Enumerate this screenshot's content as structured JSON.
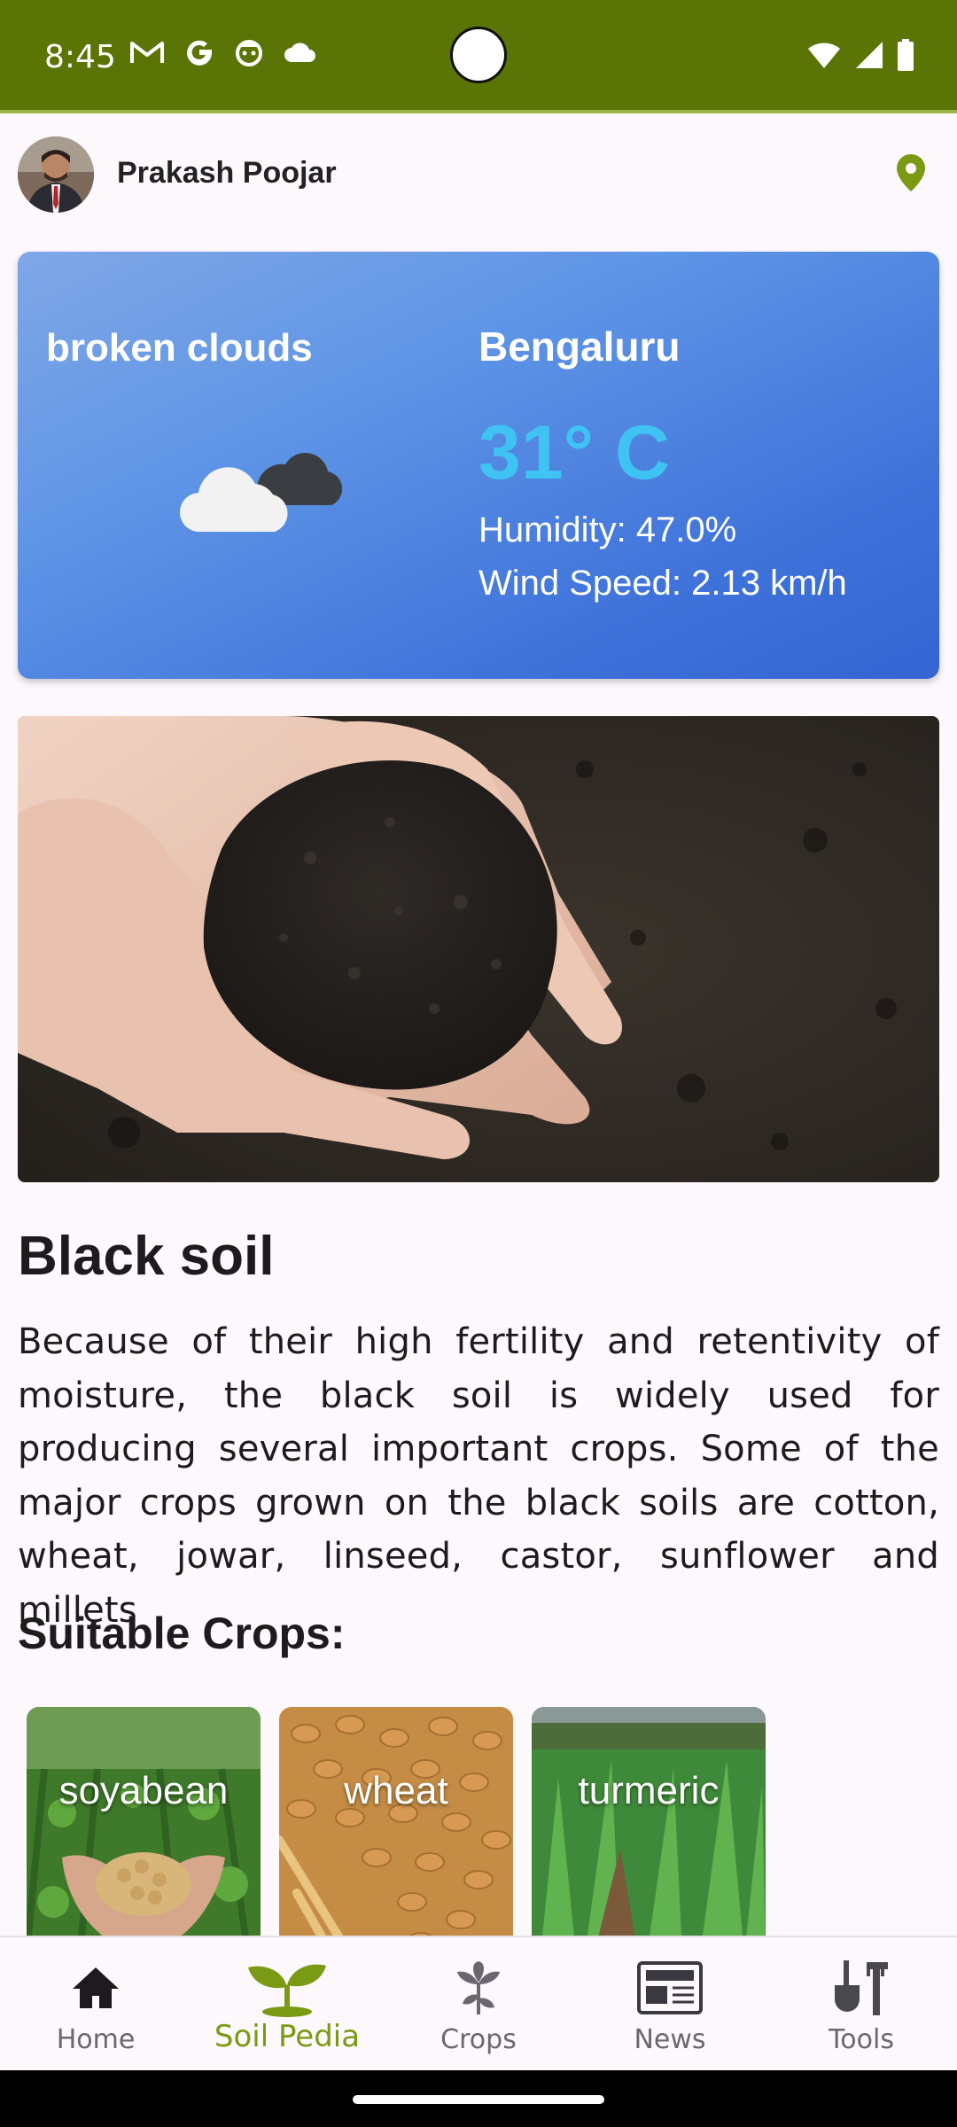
{
  "status_bar": {
    "time": "8:45",
    "left_icons": [
      "gmail-icon",
      "google-icon",
      "assistant-icon",
      "cloud-icon"
    ],
    "right_icons": [
      "wifi-icon",
      "signal-icon",
      "battery-icon"
    ],
    "background": "#5a7405"
  },
  "header": {
    "user_name": "Prakash Poojar",
    "location_icon": "location-pin-icon",
    "accent": "#7a9a13"
  },
  "weather": {
    "description": "broken clouds",
    "city": "Bengaluru",
    "temperature": "31° C",
    "humidity": "Humidity: 47.0%",
    "wind_speed": "Wind Speed: 2.13 km/h",
    "icon": "broken-clouds-icon",
    "temp_color": "#3ec3f2"
  },
  "soil": {
    "title": "Black soil",
    "description": "Because of their high fertility and retentivity of moisture, the black soil is widely used for producing several important crops. Some of the major crops grown on the black soils are cotton, wheat, jowar, linseed, castor, sunflower and millets",
    "crops_heading": "Suitable Crops:",
    "crops": [
      {
        "name": "soyabean"
      },
      {
        "name": "wheat"
      },
      {
        "name": "turmeric"
      }
    ]
  },
  "bottom_nav": {
    "items": [
      {
        "label": "Home",
        "icon": "home-icon",
        "active": false
      },
      {
        "label": "Soil Pedia",
        "icon": "sprout-icon",
        "active": true
      },
      {
        "label": "Crops",
        "icon": "crop-plant-icon",
        "active": false
      },
      {
        "label": "News",
        "icon": "newspaper-icon",
        "active": false
      },
      {
        "label": "Tools",
        "icon": "tools-icon",
        "active": false
      }
    ]
  }
}
